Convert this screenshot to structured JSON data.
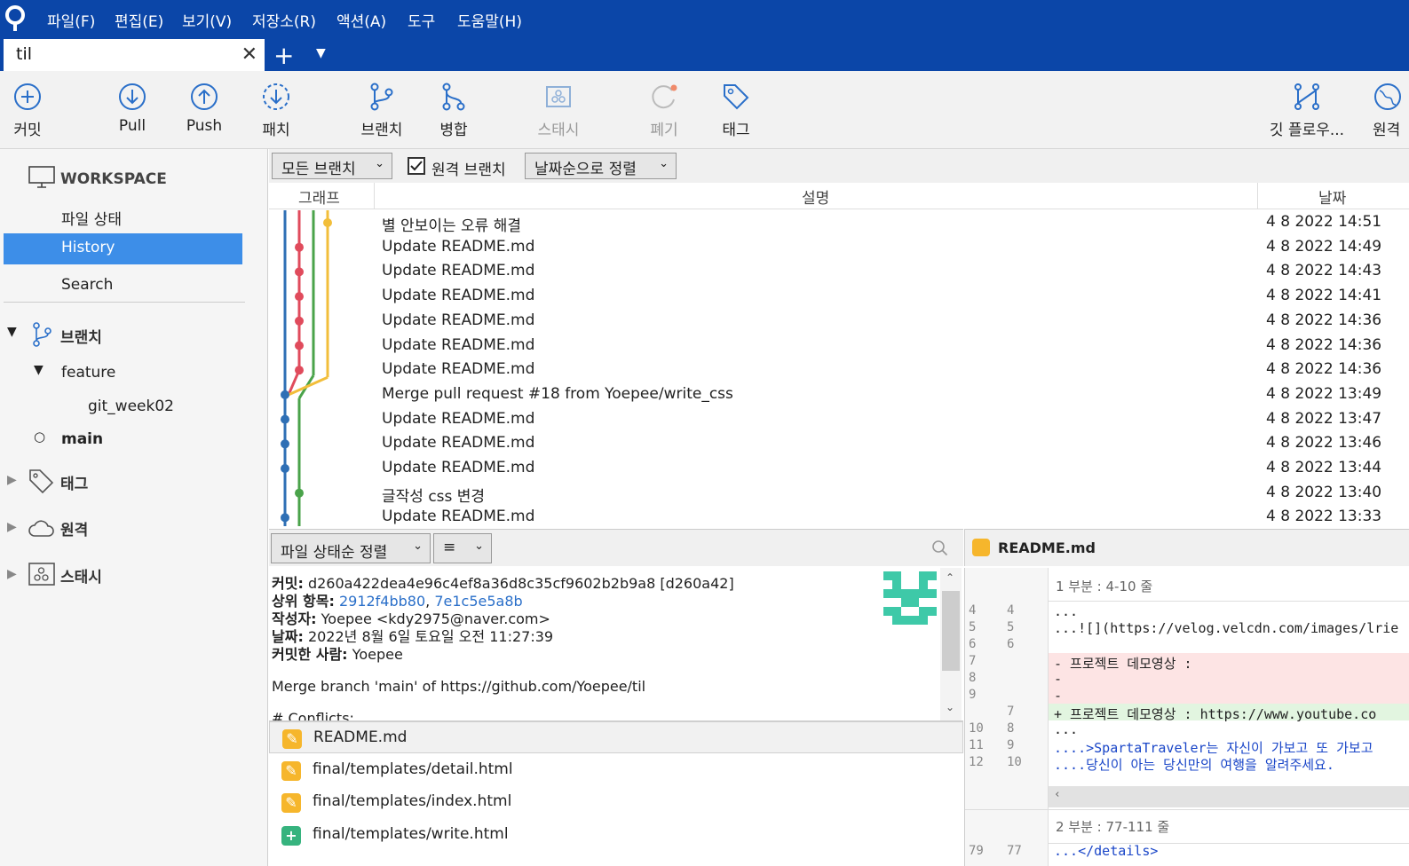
{
  "menu": [
    "파일(F)",
    "편집(E)",
    "보기(V)",
    "저장소(R)",
    "액션(A)",
    "도구",
    "도움말(H)"
  ],
  "tab": {
    "title": "til"
  },
  "toolbar": {
    "commit": "커밋",
    "pull": "Pull",
    "push": "Push",
    "patch": "패치",
    "branch": "브랜치",
    "merge": "병합",
    "stash": "스태시",
    "discard": "폐기",
    "tag": "태그",
    "gitflow": "깃 플로우...",
    "remote": "원격"
  },
  "sidebar": {
    "workspace": "WORKSPACE",
    "file_status": "파일 상태",
    "history": "History",
    "search": "Search",
    "branches": "브랜치",
    "feature": "feature",
    "git_week02": "git_week02",
    "main": "main",
    "tags": "태그",
    "remotes": "원격",
    "stashes": "스태시"
  },
  "filter": {
    "all_branches": "모든 브랜치",
    "remote_branches": "원격 브랜치",
    "sort": "날짜순으로 정렬"
  },
  "columns": {
    "graph": "그래프",
    "desc": "설명",
    "date": "날짜"
  },
  "commits": [
    {
      "desc": "별 안보이는 오류 해결",
      "date": "4 8 2022 14:51"
    },
    {
      "desc": "Update README.md",
      "date": "4 8 2022 14:49"
    },
    {
      "desc": "Update README.md",
      "date": "4 8 2022 14:43"
    },
    {
      "desc": "Update README.md",
      "date": "4 8 2022 14:41"
    },
    {
      "desc": "Update README.md",
      "date": "4 8 2022 14:36"
    },
    {
      "desc": "Update README.md",
      "date": "4 8 2022 14:36"
    },
    {
      "desc": "Update README.md",
      "date": "4 8 2022 14:36"
    },
    {
      "desc": "Merge pull request #18 from Yoepee/write_css",
      "date": "4 8 2022 13:49"
    },
    {
      "desc": "Update README.md",
      "date": "4 8 2022 13:47"
    },
    {
      "desc": "Update README.md",
      "date": "4 8 2022 13:46"
    },
    {
      "desc": "Update README.md",
      "date": "4 8 2022 13:44"
    },
    {
      "desc": "글작성 css 변경",
      "date": "4 8 2022 13:40"
    },
    {
      "desc": "Update README.md",
      "date": "4 8 2022 13:33"
    }
  ],
  "lower": {
    "sort": "파일 상태순 정렬",
    "view": "≡"
  },
  "details": {
    "commit_label": "커밋:",
    "commit": "d260a422dea4e96c4ef8a36d8c35cf9602b2b9a8 [d260a42]",
    "parents_label": "상위 항목:",
    "parent1": "2912f4bb80",
    "sep": ",",
    "parent2": "7e1c5e5a8b",
    "author_label": "작성자:",
    "author": "Yoepee <kdy2975@naver.com>",
    "date_label": "날짜:",
    "date": "2022년 8월 6일 토요일 오전 11:27:39",
    "committer_label": "커밋한 사람:",
    "committer": "Yoepee",
    "message": "Merge branch 'main' of https://github.com/Yoepee/til",
    "conflicts": "# Conflicts:"
  },
  "files": [
    {
      "name": "README.md",
      "status": "modified"
    },
    {
      "name": "final/templates/detail.html",
      "status": "modified"
    },
    {
      "name": "final/templates/index.html",
      "status": "modified"
    },
    {
      "name": "final/templates/write.html",
      "status": "added"
    }
  ],
  "diff": {
    "file": "README.md",
    "hunk1": "1 부분 : 4-10 줄",
    "hunk2": "2 부분 : 77-111 줄",
    "lines": [
      {
        "old": "4",
        "new": "4",
        "text": "...",
        "type": "ctx"
      },
      {
        "old": "5",
        "new": "5",
        "text": "...![](https://velog.velcdn.com/images/lrie",
        "type": "ctx"
      },
      {
        "old": "6",
        "new": "6",
        "text": "",
        "type": "ctx"
      },
      {
        "old": "7",
        "new": "",
        "text": "- 프로젝트 데모영상 :",
        "type": "del"
      },
      {
        "old": "8",
        "new": "",
        "text": "-",
        "type": "del"
      },
      {
        "old": "9",
        "new": "",
        "text": "-",
        "type": "del"
      },
      {
        "old": "",
        "new": "7",
        "text": "+ 프로젝트 데모영상 : https://www.youtube.co",
        "type": "add"
      },
      {
        "old": "10",
        "new": "8",
        "text": "...",
        "type": "ctx"
      },
      {
        "old": "11",
        "new": "9",
        "text": "....>SpartaTraveler는 자신이 가보고 또 가보고",
        "type": "ctx"
      },
      {
        "old": "12",
        "new": "10",
        "text": "....당신이 아는 당신만의 여행을 알려주세요.",
        "type": "ctx"
      }
    ],
    "tail_old": "79",
    "tail_new": "77",
    "tail_text": "...</details>"
  },
  "colors": {
    "accent": "#0b46a8",
    "selected": "#3d8ee8",
    "lane_blue": "#2e6fb5",
    "lane_red": "#e04b5c",
    "lane_green": "#4aa34a",
    "lane_yellow": "#f2be3a"
  }
}
